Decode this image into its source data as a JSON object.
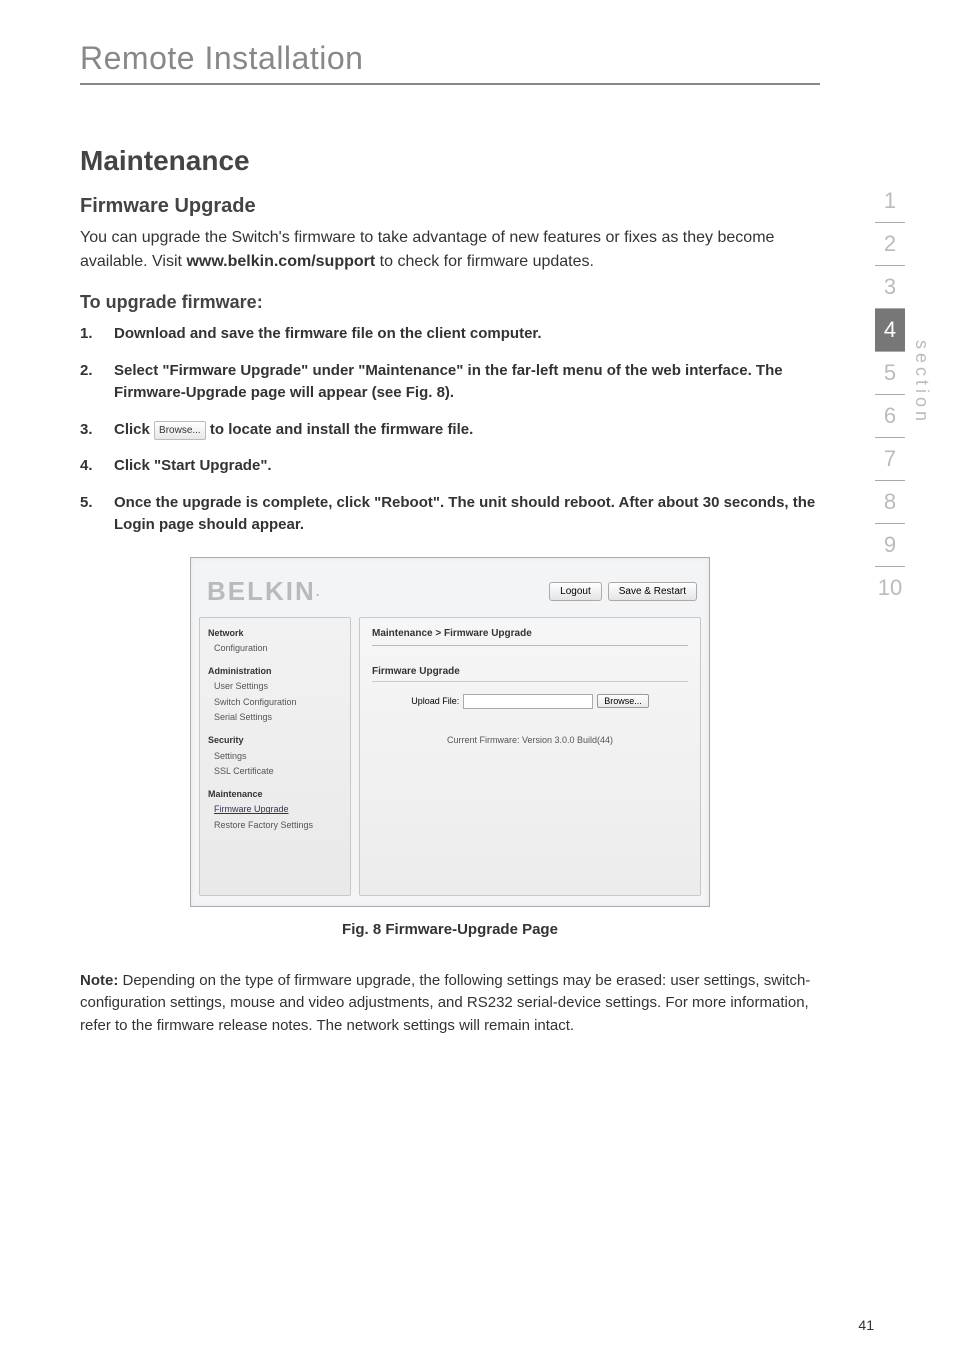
{
  "chapter": "Remote Installation",
  "h1": "Maintenance",
  "h2": "Firmware Upgrade",
  "intro": {
    "t1": "You can upgrade the Switch's firmware to take advantage of new features or fixes as they become available. Visit ",
    "link": "www.belkin.com/support",
    "t2": " to check for firmware updates."
  },
  "h2b": "To upgrade firmware:",
  "steps": {
    "s1": "Download and save the firmware file on the client computer.",
    "s2": "Select \"Firmware Upgrade\" under \"Maintenance\" in the far-left menu of the web interface. The Firmware-Upgrade page will appear (see Fig. 8).",
    "s3a": "Click ",
    "inline_browse": "Browse...",
    "s3b": " to locate and install the firmware file.",
    "s4": "Click \"Start Upgrade\".",
    "s5": "Once the upgrade is complete, click \"Reboot\". The unit should reboot. After about 30 seconds, the Login page should appear."
  },
  "screenshot": {
    "brand": "BELKIN",
    "buttons": {
      "logout": "Logout",
      "save": "Save & Restart"
    },
    "sidebar": {
      "network": {
        "title": "Network",
        "items": [
          "Configuration"
        ]
      },
      "admin": {
        "title": "Administration",
        "items": [
          "User Settings",
          "Switch Configuration",
          "Serial Settings"
        ]
      },
      "security": {
        "title": "Security",
        "items": [
          "Settings",
          "SSL Certificate"
        ]
      },
      "maint": {
        "title": "Maintenance",
        "items": [
          {
            "label": "Firmware Upgrade",
            "link": true
          },
          {
            "label": "Restore Factory Settings",
            "link": false
          }
        ]
      }
    },
    "main": {
      "breadcrumb": "Maintenance > Firmware Upgrade",
      "panel_title": "Firmware Upgrade",
      "upload_label": "Upload File:",
      "browse_btn": "Browse...",
      "current_fw": "Current Firmware: Version 3.0.0 Build(44)"
    }
  },
  "fig_caption": "Fig. 8 Firmware-Upgrade Page",
  "note": {
    "label": "Note:",
    "text": " Depending on the type of firmware upgrade, the following settings may be erased: user settings, switch-configuration settings, mouse and video adjustments, and RS232 serial-device settings. For more information, refer to the firmware release notes. The network settings will remain intact."
  },
  "ladder": {
    "label": "section",
    "numbers": [
      "1",
      "2",
      "3",
      "4",
      "5",
      "6",
      "7",
      "8",
      "9",
      "10"
    ],
    "active": "4"
  },
  "page_number": "41"
}
